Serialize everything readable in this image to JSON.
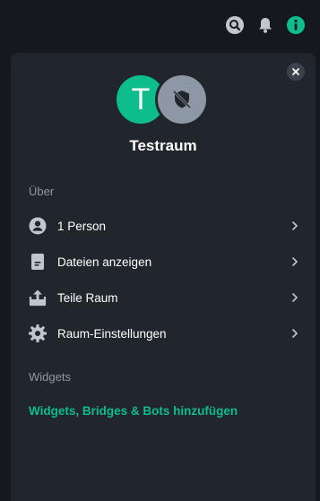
{
  "topbar": {
    "icons": [
      "search-icon",
      "bell-icon",
      "info-icon"
    ]
  },
  "panel": {
    "close_icon": "close-icon",
    "avatar_letter": "T",
    "room_name": "Testraum",
    "about_heading": "Über",
    "items": [
      {
        "label": "1 Person",
        "icon": "person-icon"
      },
      {
        "label": "Dateien anzeigen",
        "icon": "file-icon"
      },
      {
        "label": "Teile Raum",
        "icon": "share-icon"
      },
      {
        "label": "Raum-Einstellungen",
        "icon": "settings-icon"
      }
    ],
    "widgets_heading": "Widgets",
    "widgets_link": "Widgets, Bridges & Bots hinzufügen"
  },
  "colors": {
    "accent": "#0dbd8b",
    "background": "#15191e",
    "panel": "#21262c",
    "text_muted": "#8e99a4"
  }
}
